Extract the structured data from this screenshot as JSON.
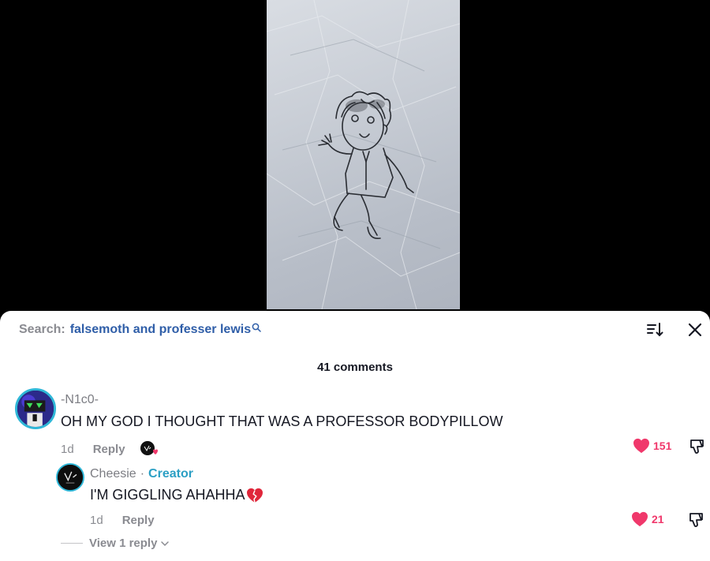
{
  "search": {
    "label": "Search:",
    "term": "falsemoth and professer lewis"
  },
  "comments_count": "41 comments",
  "comments": [
    {
      "username": "-N1c0-",
      "text": "OH MY GOD I THOUGHT THAT WAS A PROFESSOR BODYPILLOW",
      "time": "1d",
      "reply_label": "Reply",
      "likes": "151",
      "liked_by_creator": true
    }
  ],
  "reply": {
    "username": "Cheesie",
    "separator": "·",
    "badge": "Creator",
    "text": "I'M GIGGLING AHAHHA",
    "emoji": "broken-heart-icon",
    "time": "1d",
    "reply_label": "Reply",
    "likes": "21"
  },
  "view_replies": "View 1 reply",
  "colors": {
    "like": "#f0386b",
    "search_term": "#2f5ea8",
    "creator_badge": "#2b9fc4",
    "avatar_ring": "#2fb7d8"
  }
}
